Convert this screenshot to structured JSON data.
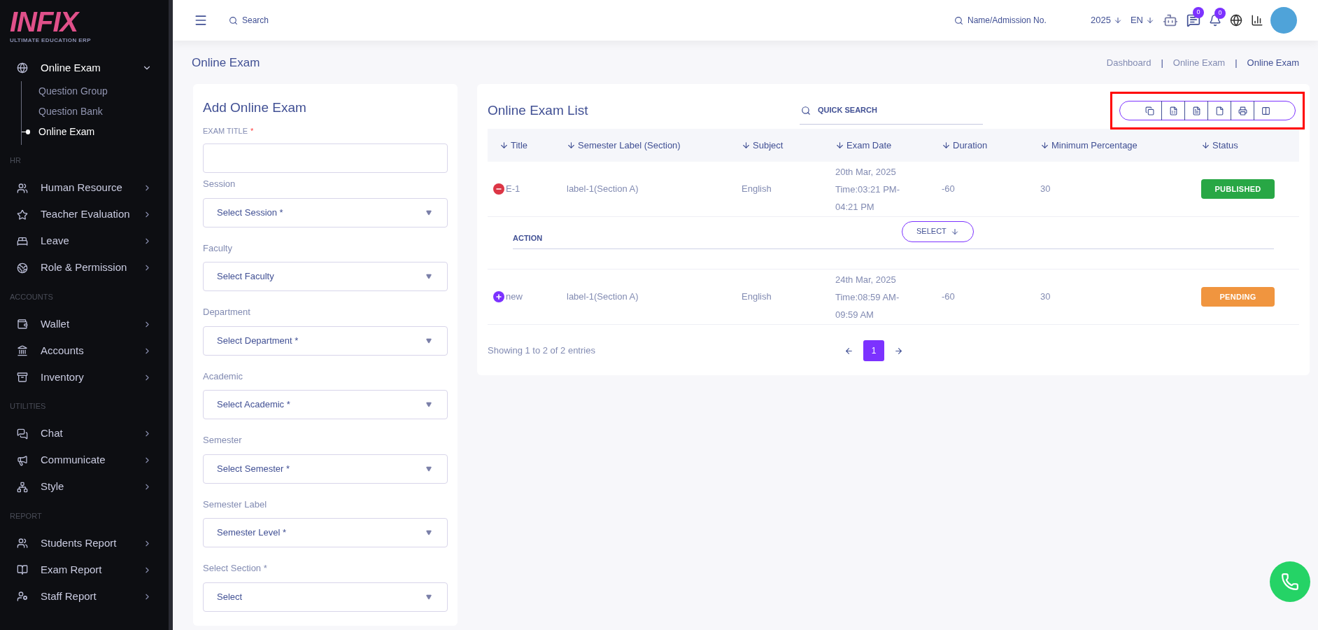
{
  "logo": {
    "text": "INFIX",
    "tagline": "ULTIMATE EDUCATION ERP"
  },
  "sidebar": {
    "sections": [
      {
        "items": [
          {
            "label": "Online Exam",
            "expanded": true,
            "children": [
              {
                "label": "Question Group",
                "selected": false
              },
              {
                "label": "Question Bank",
                "selected": false
              },
              {
                "label": "Online Exam",
                "selected": true
              }
            ]
          }
        ]
      },
      {
        "heading": "HR",
        "items": [
          {
            "label": "Human Resource",
            "expanded": false
          },
          {
            "label": "Teacher Evaluation",
            "expanded": false
          },
          {
            "label": "Leave",
            "expanded": false
          },
          {
            "label": "Role & Permission",
            "expanded": false
          }
        ]
      },
      {
        "heading": "ACCOUNTS",
        "items": [
          {
            "label": "Wallet",
            "expanded": false
          },
          {
            "label": "Accounts",
            "expanded": false
          },
          {
            "label": "Inventory",
            "expanded": false
          }
        ]
      },
      {
        "heading": "UTILITIES",
        "items": [
          {
            "label": "Chat",
            "expanded": false
          },
          {
            "label": "Communicate",
            "expanded": false
          },
          {
            "label": "Style",
            "expanded": false
          }
        ]
      },
      {
        "heading": "REPORT",
        "items": [
          {
            "label": "Students Report",
            "expanded": false
          },
          {
            "label": "Exam Report",
            "expanded": false
          },
          {
            "label": "Staff Report",
            "expanded": false
          }
        ]
      }
    ]
  },
  "topbar": {
    "search": {
      "placeholder": "Search"
    },
    "student_search": {
      "placeholder": "Name/Admission No."
    },
    "year": "2025",
    "language": "EN",
    "chat_count": "0",
    "notification_count": "0"
  },
  "page_title": "Online Exam",
  "breadcrumbs": [
    {
      "label": "Dashboard",
      "current": false,
      "separator": "|"
    },
    {
      "label": "Online Exam",
      "current": false,
      "separator": "|"
    },
    {
      "label": "Online Exam",
      "current": true
    }
  ],
  "form": {
    "title": "Add Online Exam",
    "fields": [
      {
        "kind": "text",
        "label": "EXAM TITLE",
        "required_mark": "*"
      },
      {
        "kind": "select",
        "label": "Session",
        "placeholder": "Select Session *"
      },
      {
        "kind": "select",
        "label": "Faculty",
        "placeholder": "Select Faculty"
      },
      {
        "kind": "select",
        "label": "Department",
        "placeholder": "Select Department *"
      },
      {
        "kind": "select",
        "label": "Academic",
        "placeholder": "Select Academic *"
      },
      {
        "kind": "select",
        "label": "Semester",
        "placeholder": "Select Semester *"
      },
      {
        "kind": "select",
        "label": "Semester Label",
        "placeholder": "Semester Level *"
      },
      {
        "kind": "select",
        "label": "Select Section *",
        "placeholder": "Select"
      }
    ]
  },
  "list": {
    "title": "Online Exam List",
    "search": {
      "placeholder": "QUICK SEARCH"
    },
    "columns": [
      "Title",
      "Semester Label (Section)",
      "Subject",
      "Exam Date",
      "Duration",
      "Minimum Percentage",
      "Status"
    ],
    "rows": [
      {
        "expanded": true,
        "title": "E-1",
        "section": "label-1(Section A)",
        "subject": "English",
        "date": [
          "20th Mar, 2025",
          "Time:03:21 PM-",
          "04:21 PM"
        ],
        "duration": "-60",
        "minimum": "30",
        "status": {
          "kind": "published",
          "label": "PUBLISHED"
        },
        "action_label": "ACTION",
        "action_button": "SELECT"
      },
      {
        "expanded": false,
        "title": "new",
        "section": "label-1(Section A)",
        "subject": "English",
        "date": [
          "24th Mar, 2025",
          "Time:08:59 AM-",
          "09:59 AM"
        ],
        "duration": "-60",
        "minimum": "30",
        "status": {
          "kind": "pending",
          "label": "PENDING"
        }
      }
    ],
    "footer": "Showing 1 to 2 of 2 entries",
    "pages": [
      {
        "label": "1",
        "selected": true
      }
    ]
  }
}
